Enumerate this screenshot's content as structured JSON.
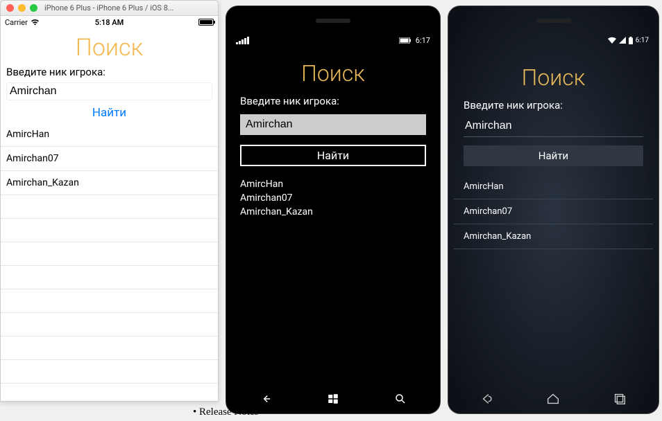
{
  "mac": {
    "title": "iPhone 6 Plus - iPhone 6 Plus / iOS 8..."
  },
  "ios": {
    "statusbar": {
      "carrier": "Carrier",
      "time": "5:18 AM"
    },
    "title": "Поиск",
    "prompt": "Введите ник игрока:",
    "input_value": "Amirchan",
    "button": "Найти",
    "results": [
      "AmircHan",
      "Amirchan07",
      "Amirchan_Kazan"
    ]
  },
  "wp": {
    "statusbar": {
      "time": "6:17"
    },
    "title": "Поиск",
    "prompt": "Введите ник игрока:",
    "input_value": "Amirchan",
    "button": "Найти",
    "results": [
      "AmircHan",
      "Amirchan07",
      "Amirchan_Kazan"
    ]
  },
  "android": {
    "statusbar": {
      "time": "6:17"
    },
    "title": "Поиск",
    "prompt": "Введите ник игрока:",
    "input_value": "Amirchan",
    "button": "Найти",
    "results": [
      "AmircHan",
      "Amirchan07",
      "Amirchan_Kazan"
    ]
  },
  "footer_bullet": "Release Notes"
}
